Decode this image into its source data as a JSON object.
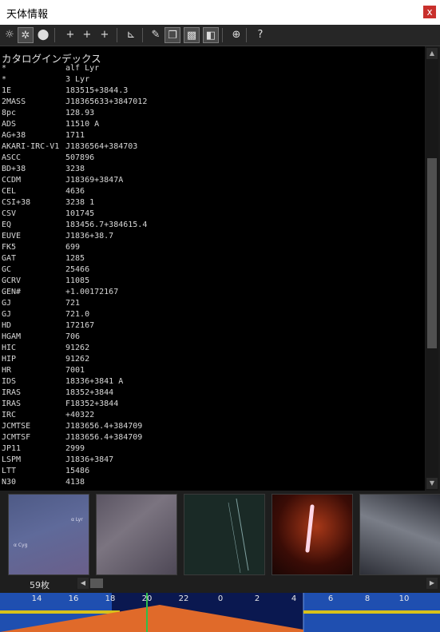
{
  "window": {
    "title": "天体情報",
    "close_glyph": "x"
  },
  "toolbar": {
    "buttons": [
      {
        "name": "sun-icon",
        "glyph": "☼"
      },
      {
        "name": "target-x-icon",
        "glyph": "✲"
      },
      {
        "name": "palette-icon",
        "glyph": "⬤"
      },
      {
        "name": "crosshair-icon",
        "glyph": "+"
      },
      {
        "name": "crosshair-plus-icon",
        "glyph": "+"
      },
      {
        "name": "crosshair-star-icon",
        "glyph": "+"
      },
      {
        "name": "telescope-icon",
        "glyph": "⊾"
      },
      {
        "name": "pencil-icon",
        "glyph": "✎"
      },
      {
        "name": "windows-icon",
        "glyph": "❐"
      },
      {
        "name": "landscape-icon",
        "glyph": "▩"
      },
      {
        "name": "panel-icon",
        "glyph": "◧"
      },
      {
        "name": "compass-icon",
        "glyph": "⊕"
      },
      {
        "name": "help-icon",
        "glyph": "?"
      }
    ]
  },
  "catalog": {
    "header": "カタログインデックス",
    "entries": [
      {
        "key": "*",
        "value": "alf Lyr"
      },
      {
        "key": "*",
        "value": "3 Lyr"
      },
      {
        "key": "1E",
        "value": "183515+3844.3"
      },
      {
        "key": "2MASS",
        "value": "J18365633+3847012"
      },
      {
        "key": "8pc",
        "value": "128.93"
      },
      {
        "key": "ADS",
        "value": "11510 A"
      },
      {
        "key": "AG+38",
        "value": "1711"
      },
      {
        "key": "AKARI-IRC-V1",
        "value": "J1836564+384703"
      },
      {
        "key": "ASCC",
        "value": "507896"
      },
      {
        "key": "BD+38",
        "value": "3238"
      },
      {
        "key": "CCDM",
        "value": "J18369+3847A"
      },
      {
        "key": "CEL",
        "value": "4636"
      },
      {
        "key": "CSI+38",
        "value": "3238 1"
      },
      {
        "key": "CSV",
        "value": "101745"
      },
      {
        "key": "EQ",
        "value": "183456.7+384615.4"
      },
      {
        "key": "EUVE",
        "value": "J1836+38.7"
      },
      {
        "key": "FK5",
        "value": "699"
      },
      {
        "key": "GAT",
        "value": "1285"
      },
      {
        "key": "GC",
        "value": "25466"
      },
      {
        "key": "GCRV",
        "value": "11085"
      },
      {
        "key": "GEN#",
        "value": "+1.00172167"
      },
      {
        "key": "GJ",
        "value": "721"
      },
      {
        "key": "GJ",
        "value": "721.0"
      },
      {
        "key": "HD",
        "value": "172167"
      },
      {
        "key": "HGAM",
        "value": "706"
      },
      {
        "key": "HIC",
        "value": "91262"
      },
      {
        "key": "HIP",
        "value": "91262"
      },
      {
        "key": "HR",
        "value": "7001"
      },
      {
        "key": "IDS",
        "value": "18336+3841 A"
      },
      {
        "key": "IRAS",
        "value": "18352+3844"
      },
      {
        "key": "IRAS",
        "value": "F18352+3844"
      },
      {
        "key": "IRC",
        "value": "+40322"
      },
      {
        "key": "JCMTSE",
        "value": "J183656.4+384709"
      },
      {
        "key": "JCMTSF",
        "value": "J183656.4+384709"
      },
      {
        "key": "JP11",
        "value": "2999"
      },
      {
        "key": "LSPM",
        "value": "J1836+3847"
      },
      {
        "key": "LTT",
        "value": "15486"
      },
      {
        "key": "N30",
        "value": "4138"
      }
    ]
  },
  "thumbnails": [
    {
      "name": "sky-photo-1",
      "labels": [
        "α Lyr",
        "α Cyg"
      ]
    },
    {
      "name": "sky-photo-2",
      "labels": []
    },
    {
      "name": "sky-photo-3",
      "labels": []
    },
    {
      "name": "sky-photo-4",
      "labels": []
    },
    {
      "name": "sky-photo-5",
      "labels": []
    }
  ],
  "photo_count": "59枚",
  "timeline": {
    "hours": [
      "14",
      "16",
      "18",
      "20",
      "22",
      "0",
      "2",
      "4",
      "6",
      "8",
      "10"
    ],
    "current_hour": "20",
    "colors": {
      "day": "#1f4fb0",
      "night": "#0a1850",
      "altitude_curve": "#e06a2a",
      "track": "#d9c21a",
      "marker": "#2ec04a"
    }
  }
}
